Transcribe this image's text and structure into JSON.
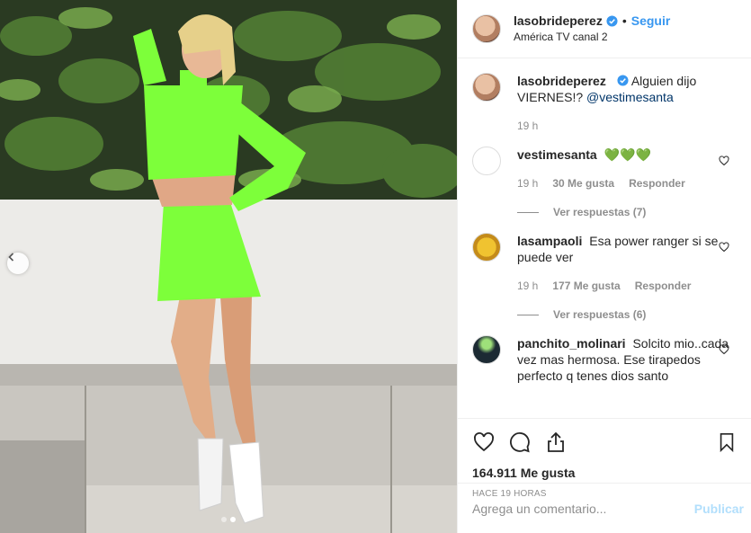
{
  "header": {
    "username": "lasobrideperez",
    "separator": "•",
    "follow_label": "Seguir",
    "location": "América TV canal 2"
  },
  "caption": {
    "username": "lasobrideperez",
    "text": "Alguien dijo VIERNES!?",
    "mention": "@vestimesanta",
    "time": "19 h"
  },
  "comments": [
    {
      "username": "vestimesanta",
      "text": "💚💚💚",
      "time": "19 h",
      "likes": "30 Me gusta",
      "reply_label": "Responder",
      "replies": "Ver respuestas (7)"
    },
    {
      "username": "lasampaoli",
      "text": "Esa power ranger si se puede ver",
      "time": "19 h",
      "likes": "177 Me gusta",
      "reply_label": "Responder",
      "replies": "Ver respuestas (6)"
    },
    {
      "username": "panchito_molinari",
      "text": "Solcito mio..cada vez mas hermosa. Ese tirapedos perfecto q tenes dios santo"
    }
  ],
  "footer": {
    "likes": "164.911 Me gusta",
    "time_ago": "HACE 19 HORAS",
    "comment_placeholder": "Agrega un comentario...",
    "publish_label": "Publicar"
  },
  "carousel": {
    "total": 2,
    "active": 1
  },
  "colors": {
    "accent": "#3897f0",
    "outfit": "#7dff3a"
  }
}
